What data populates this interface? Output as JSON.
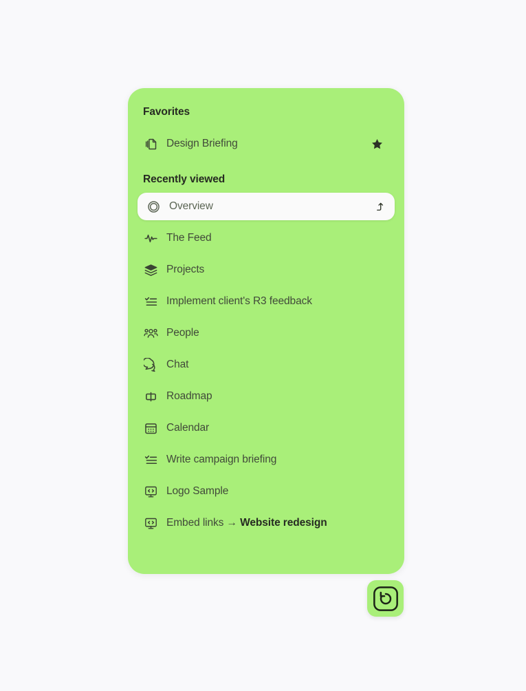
{
  "colors": {
    "page_background": "#f9f9fb",
    "panel_background": "#a9ef79",
    "selected_row_background": "#fafafa",
    "text_primary": "#262b22",
    "text_secondary": "#414a3a",
    "icon": "#3a4433"
  },
  "panel": {
    "favorites": {
      "title": "Favorites",
      "items": [
        {
          "label": "Design Briefing",
          "icon": "copy-documents-icon",
          "trailing_icon": "star-filled-icon",
          "favorited": true
        }
      ]
    },
    "recently_viewed": {
      "title": "Recently viewed",
      "items": [
        {
          "label": "Overview",
          "icon": "double-circle-icon",
          "selected": true,
          "trailing_icon": "arrow-turn-up-icon"
        },
        {
          "label": "The Feed",
          "icon": "activity-pulse-icon",
          "selected": false
        },
        {
          "label": "Projects",
          "icon": "stacked-layers-icon",
          "selected": false
        },
        {
          "label": "Implement client's R3 feedback",
          "icon": "checklist-task-icon",
          "selected": false
        },
        {
          "label": "People",
          "icon": "people-group-icon",
          "selected": false
        },
        {
          "label": "Chat",
          "icon": "chat-bubbles-icon",
          "selected": false
        },
        {
          "label": "Roadmap",
          "icon": "roadmap-bar-icon",
          "selected": false
        },
        {
          "label": "Calendar",
          "icon": "calendar-icon",
          "selected": false
        },
        {
          "label": "Write campaign briefing",
          "icon": "checklist-task-icon",
          "selected": false
        },
        {
          "label": "Logo Sample",
          "icon": "embed-code-monitor-icon",
          "selected": false
        },
        {
          "label": "Embed links → ",
          "label_strong": "Website redesign",
          "icon": "embed-code-monitor-icon",
          "selected": false
        }
      ]
    }
  },
  "badge_button": {
    "icon": "restore-history-icon",
    "label": ""
  }
}
